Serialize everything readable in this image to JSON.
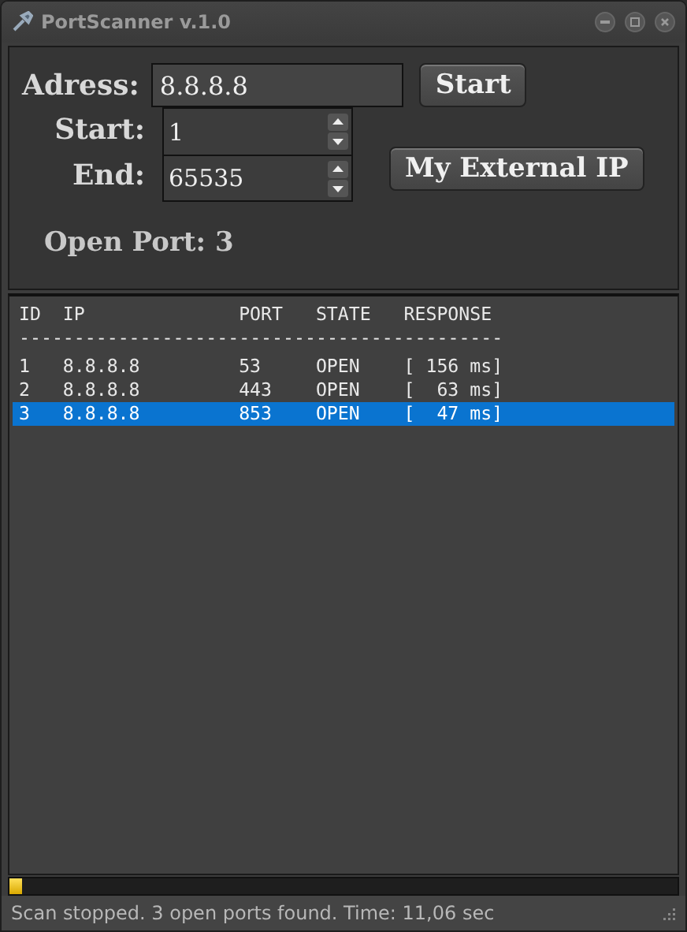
{
  "window": {
    "title": "PortScanner v.1.0"
  },
  "form": {
    "address_label": "Adress:",
    "address": "8.8.8.8",
    "start_button": "Start",
    "start_label": "Start:",
    "start": "1",
    "end_label": "End:",
    "end": "65535",
    "external_ip_button": "My External IP",
    "open_port": "Open Port: 3"
  },
  "table": {
    "columns": [
      "ID",
      "IP",
      "PORT",
      "STATE",
      "RESPONSE"
    ],
    "separator": "--------------------------------------------",
    "rows": [
      {
        "cells": [
          "1",
          "8.8.8.8",
          "53",
          "OPEN",
          "[ 156 ms]"
        ],
        "selected": false
      },
      {
        "cells": [
          "2",
          "8.8.8.8",
          "443",
          "OPEN",
          "[  63 ms]"
        ],
        "selected": false
      },
      {
        "cells": [
          "3",
          "8.8.8.8",
          "853",
          "OPEN",
          "[  47 ms]"
        ],
        "selected": true
      }
    ]
  },
  "progress": {
    "level": 0.02
  },
  "status_bar": "Scan stopped. 3 open ports found. Time: 11,06 sec"
}
